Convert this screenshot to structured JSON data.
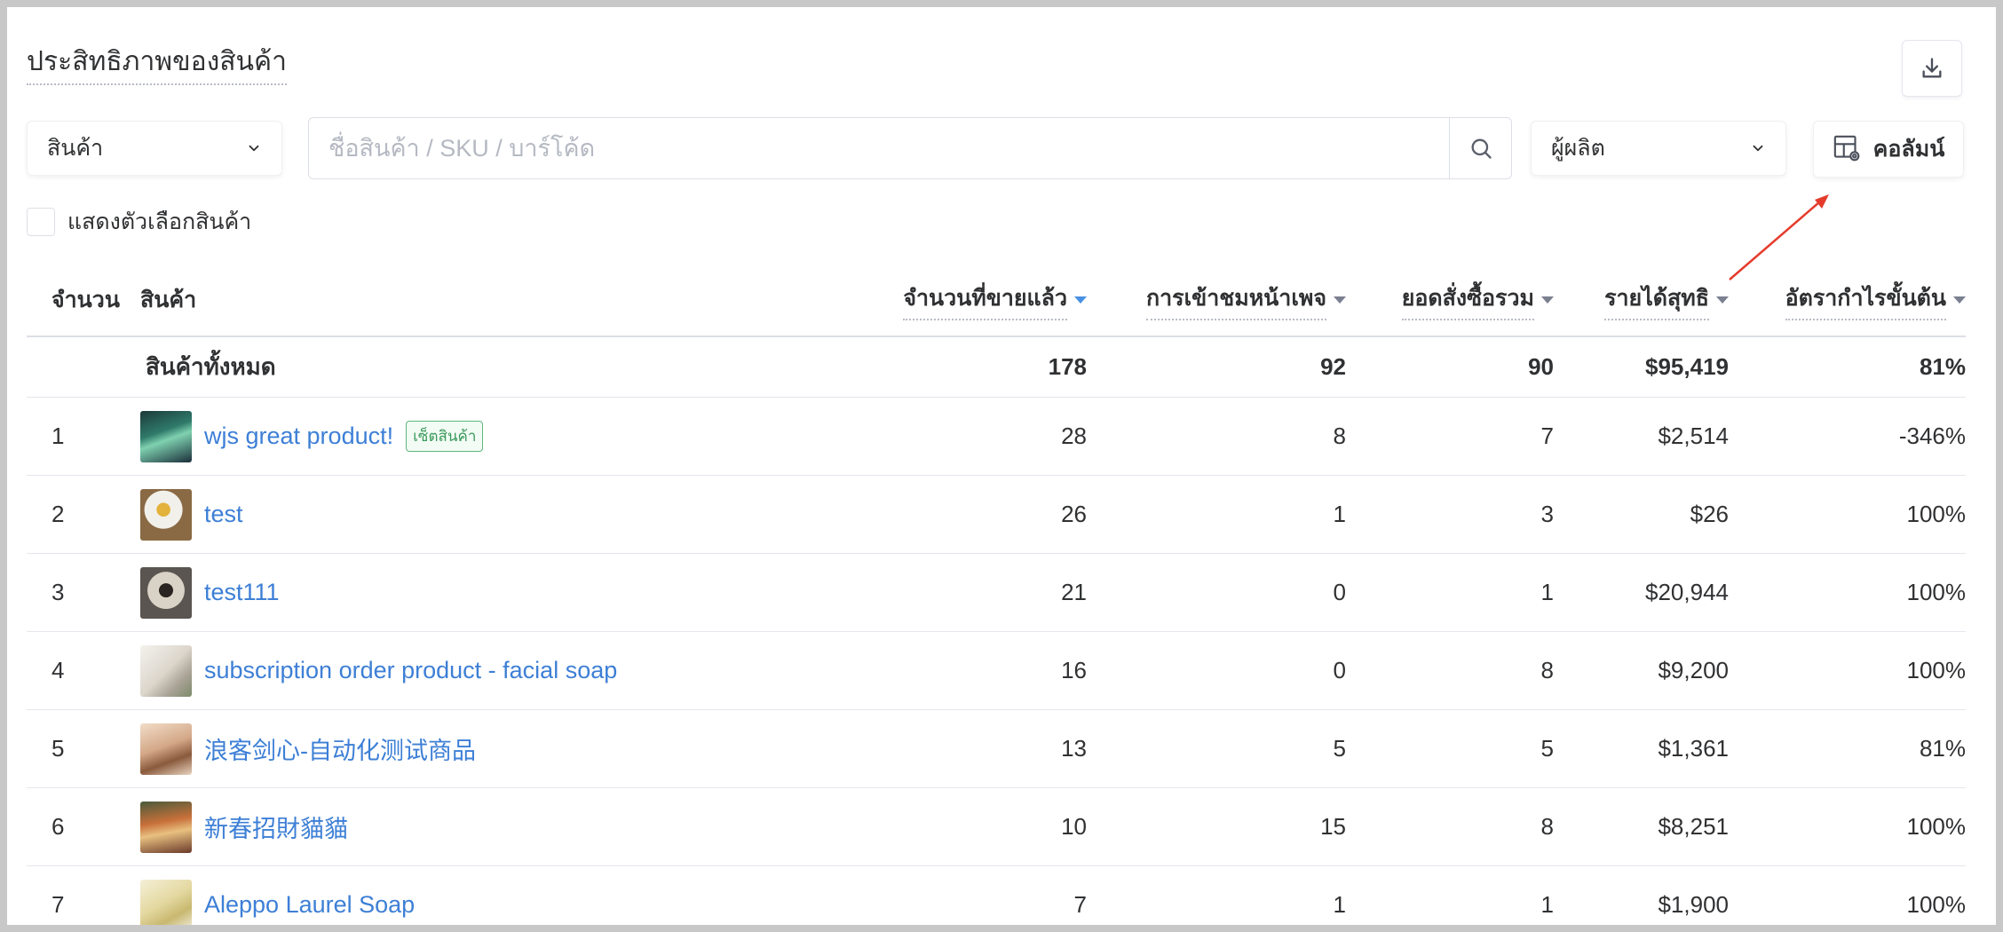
{
  "page": {
    "title": "ประสิทธิภาพของสินค้า"
  },
  "filters": {
    "product_select": "สินค้า",
    "search_placeholder": "ชื่อสินค้า / SKU / บาร์โค้ด",
    "maker_select": "ผู้ผลิต",
    "columns_button": "คอลัมน์",
    "show_options_label": "แสดงตัวเลือกสินค้า"
  },
  "table": {
    "headers": {
      "num": "จำนวน",
      "product": "สินค้า",
      "sold": "จำนวนที่ขายแล้ว",
      "views": "การเข้าชมหน้าเพจ",
      "orders": "ยอดสั่งซื้อรวม",
      "revenue": "รายได้สุทธิ",
      "margin": "อัตรากำไรขั้นต้น"
    },
    "total": {
      "label": "สินค้าทั้งหมด",
      "sold": "178",
      "views": "92",
      "orders": "90",
      "revenue": "$95,419",
      "margin": "81%"
    },
    "rows": [
      {
        "num": "1",
        "name": "wjs great product!",
        "badge": "เซ็ตสินค้า",
        "sold": "28",
        "views": "8",
        "orders": "7",
        "revenue": "$2,514",
        "margin": "-346%"
      },
      {
        "num": "2",
        "name": "test",
        "sold": "26",
        "views": "1",
        "orders": "3",
        "revenue": "$26",
        "margin": "100%"
      },
      {
        "num": "3",
        "name": "test111",
        "sold": "21",
        "views": "0",
        "orders": "1",
        "revenue": "$20,944",
        "margin": "100%"
      },
      {
        "num": "4",
        "name": "subscription order product - facial soap",
        "sold": "16",
        "views": "0",
        "orders": "8",
        "revenue": "$9,200",
        "margin": "100%"
      },
      {
        "num": "5",
        "name": "浪客剑心-自动化测试商品",
        "sold": "13",
        "views": "5",
        "orders": "5",
        "revenue": "$1,361",
        "margin": "81%"
      },
      {
        "num": "6",
        "name": "新春招財貓貓",
        "sold": "10",
        "views": "15",
        "orders": "8",
        "revenue": "$8,251",
        "margin": "100%"
      },
      {
        "num": "7",
        "name": "Aleppo Laurel Soap",
        "sold": "7",
        "views": "1",
        "orders": "1",
        "revenue": "$1,900",
        "margin": "100%"
      }
    ]
  },
  "colors": {
    "link": "#3d7fd6",
    "sort_active": "#4a90e2",
    "badge": "#3a9a5a",
    "annotation_arrow": "#e53b2c"
  }
}
